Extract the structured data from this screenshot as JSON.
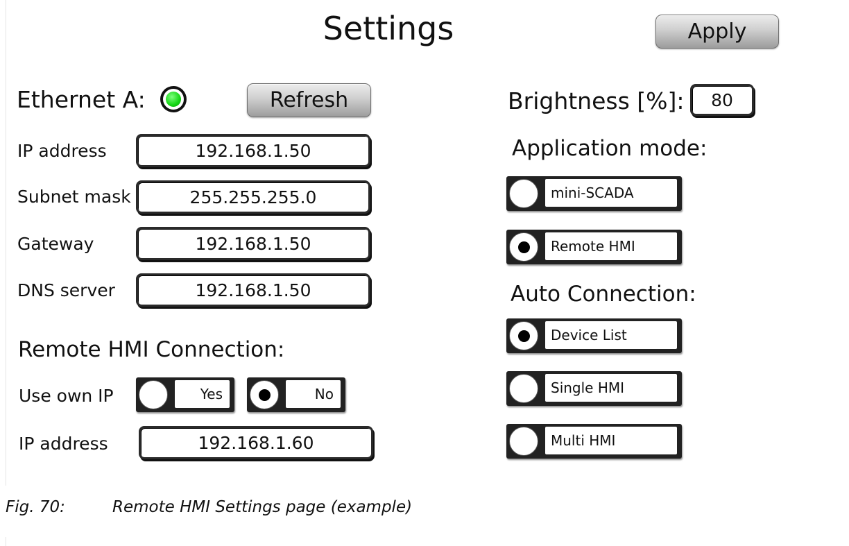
{
  "page": {
    "title": "Settings",
    "apply_label": "Apply"
  },
  "ethernet": {
    "label": "Ethernet A:",
    "status_color": "#14d614",
    "refresh_label": "Refresh",
    "fields": {
      "ip_label": "IP address",
      "ip_value": "192.168.1.50",
      "subnet_label": "Subnet mask",
      "subnet_value": "255.255.255.0",
      "gateway_label": "Gateway",
      "gateway_value": "192.168.1.50",
      "dns_label": "DNS server",
      "dns_value": "192.168.1.50"
    }
  },
  "remote_hmi": {
    "heading": "Remote HMI Connection:",
    "use_own_ip_label": "Use own IP",
    "yes_label": "Yes",
    "no_label": "No",
    "use_own_ip_selected": "No",
    "ip_label": "IP address",
    "ip_value": "192.168.1.60"
  },
  "brightness": {
    "label": "Brightness [%]:",
    "value": "80"
  },
  "application_mode": {
    "heading": "Application mode:",
    "options": [
      "mini-SCADA",
      "Remote HMI"
    ],
    "selected": "Remote HMI"
  },
  "auto_connection": {
    "heading": "Auto Connection:",
    "options": [
      "Device List",
      "Single HMI",
      "Multi HMI"
    ],
    "selected": "Device List"
  },
  "caption": {
    "number": "Fig. 70:",
    "text": "Remote HMI Settings page (example)"
  }
}
